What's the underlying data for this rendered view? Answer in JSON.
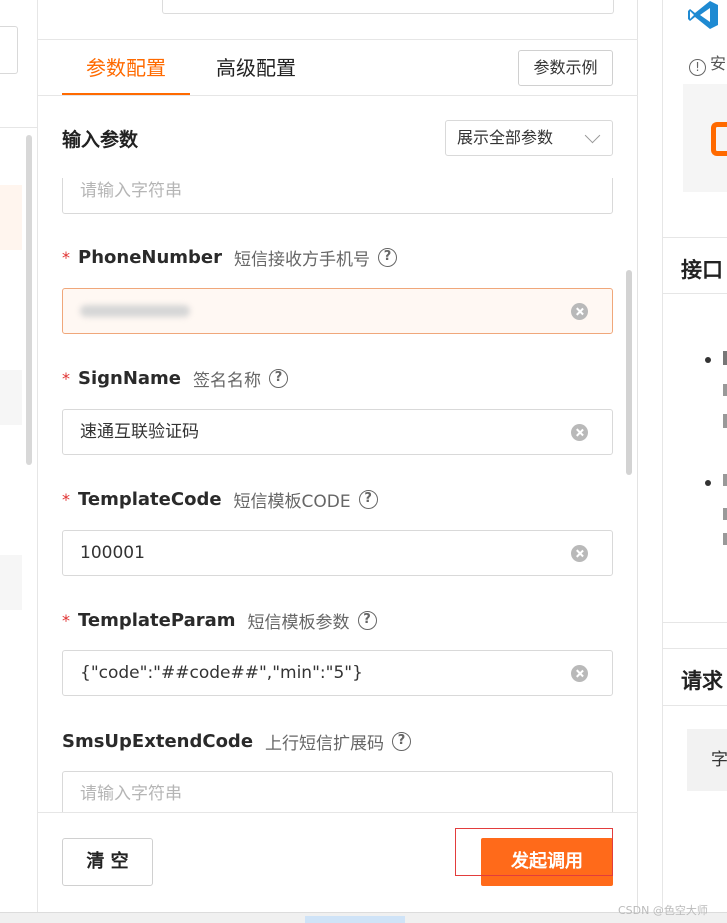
{
  "tabs": [
    {
      "label": "参数配置",
      "active": true
    },
    {
      "label": "高级配置",
      "active": false
    }
  ],
  "example_button": "参数示例",
  "section_title": "输入参数",
  "param_filter": {
    "selected": "展示全部参数"
  },
  "first_input": {
    "placeholder": "请输入字符串"
  },
  "fields": [
    {
      "name": "PhoneNumber",
      "description": "短信接收方手机号",
      "required": true,
      "value": "",
      "blurred": true
    },
    {
      "name": "SignName",
      "description": "签名名称",
      "required": true,
      "value": "速通互联验证码"
    },
    {
      "name": "TemplateCode",
      "description": "短信模板CODE",
      "required": true,
      "value": "100001"
    },
    {
      "name": "TemplateParam",
      "description": "短信模板参数",
      "required": true,
      "value": "{\"code\":\"##code##\",\"min\":\"5\"}"
    },
    {
      "name": "SmsUpExtendCode",
      "description": "上行短信扩展码",
      "required": false,
      "value": "",
      "placeholder": "请输入字符串"
    }
  ],
  "required_mark": "*",
  "help_glyph": "?",
  "footer": {
    "clear_label": "清 空",
    "invoke_label": "发起调用"
  },
  "right_panel": {
    "warning_text": "安",
    "warning_glyph": "!",
    "card2_title": "接口",
    "card3_title": "请求",
    "card3_cell": "字"
  },
  "watermark": "CSDN @色空大师",
  "colors": {
    "accent": "#ff6a00",
    "button": "#ff6a1a",
    "required": "#e0302f"
  }
}
